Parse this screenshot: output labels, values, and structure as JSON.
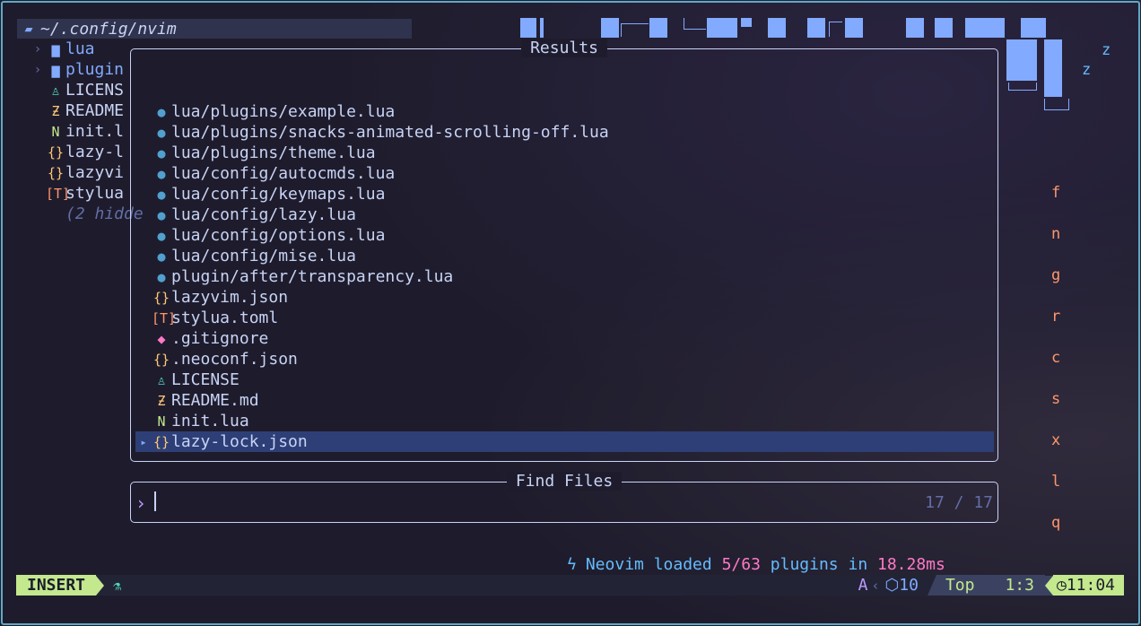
{
  "tree": {
    "root": "~/.config/nvim",
    "items": [
      {
        "label": "lua",
        "icon": "folder-icon",
        "glyph": "▆",
        "color": "#82aaff",
        "dir": true
      },
      {
        "label": "plugin",
        "icon": "folder-icon",
        "glyph": "▆",
        "color": "#82aaff",
        "dir": true
      },
      {
        "label": "LICENS",
        "icon": "license-icon",
        "glyph": "♙",
        "color": "#4fd6be"
      },
      {
        "label": "README",
        "icon": "readme-icon",
        "glyph": "Ƶ",
        "color": "#ffc777"
      },
      {
        "label": "init.l",
        "icon": "neovim-icon",
        "glyph": "N",
        "color": "#c3e88d"
      },
      {
        "label": "lazy-l",
        "icon": "json-icon",
        "glyph": "{}",
        "color": "#ffc777"
      },
      {
        "label": "lazyvi",
        "icon": "json-icon",
        "glyph": "{}",
        "color": "#ffc777"
      },
      {
        "label": "stylua",
        "icon": "toml-icon",
        "glyph": "[T]",
        "color": "#ff966c"
      },
      {
        "label": "(2 hidde",
        "icon": "",
        "glyph": "",
        "color": "#636da6",
        "hidden": true
      }
    ]
  },
  "banner": {
    "snore": [
      "z",
      "z"
    ]
  },
  "keys": [
    "f",
    "n",
    "g",
    "r",
    "c",
    "s",
    "x",
    "l",
    "q"
  ],
  "results": {
    "title": "Results",
    "items": [
      {
        "label": "lua/plugins/example.lua",
        "icon": "lua-icon",
        "glyph": "●",
        "color": "#51a0cf"
      },
      {
        "label": "lua/plugins/snacks-animated-scrolling-off.lua",
        "icon": "lua-icon",
        "glyph": "●",
        "color": "#51a0cf"
      },
      {
        "label": "lua/plugins/theme.lua",
        "icon": "lua-icon",
        "glyph": "●",
        "color": "#51a0cf"
      },
      {
        "label": "lua/config/autocmds.lua",
        "icon": "lua-icon",
        "glyph": "●",
        "color": "#51a0cf"
      },
      {
        "label": "lua/config/keymaps.lua",
        "icon": "lua-icon",
        "glyph": "●",
        "color": "#51a0cf"
      },
      {
        "label": "lua/config/lazy.lua",
        "icon": "lua-icon",
        "glyph": "●",
        "color": "#51a0cf"
      },
      {
        "label": "lua/config/options.lua",
        "icon": "lua-icon",
        "glyph": "●",
        "color": "#51a0cf"
      },
      {
        "label": "lua/config/mise.lua",
        "icon": "lua-icon",
        "glyph": "●",
        "color": "#51a0cf"
      },
      {
        "label": "plugin/after/transparency.lua",
        "icon": "lua-icon",
        "glyph": "●",
        "color": "#51a0cf"
      },
      {
        "label": "lazyvim.json",
        "icon": "json-icon",
        "glyph": "{}",
        "color": "#ffc777"
      },
      {
        "label": "stylua.toml",
        "icon": "toml-icon",
        "glyph": "[T]",
        "color": "#ff966c"
      },
      {
        "label": ".gitignore",
        "icon": "git-icon",
        "glyph": "◆",
        "color": "#ff79c6"
      },
      {
        "label": ".neoconf.json",
        "icon": "json-icon",
        "glyph": "{}",
        "color": "#ffc777"
      },
      {
        "label": "LICENSE",
        "icon": "license-icon",
        "glyph": "♙",
        "color": "#4fd6be"
      },
      {
        "label": "README.md",
        "icon": "readme-icon",
        "glyph": "Ƶ",
        "color": "#ffc777"
      },
      {
        "label": "init.lua",
        "icon": "neovim-icon",
        "glyph": "N",
        "color": "#c3e88d"
      },
      {
        "label": "lazy-lock.json",
        "icon": "json-icon",
        "glyph": "{}",
        "color": "#ffc777",
        "selected": true
      }
    ]
  },
  "prompt": {
    "title": "Find Files",
    "value": "",
    "count": "17 / 17"
  },
  "notify": {
    "prefix": "Neovim loaded",
    "loaded": "5/63",
    "mid": "plugins in",
    "time": "18.28ms"
  },
  "status": {
    "mode": "INSERT",
    "diag": "A",
    "packages": "10",
    "scroll": "Top",
    "position": "1:3",
    "clock": "11:04"
  }
}
